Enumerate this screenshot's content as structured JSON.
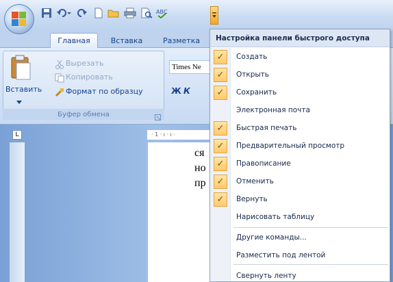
{
  "title_bar": {
    "office_button_icon": "office-logo",
    "qat_icons": [
      "save-icon",
      "undo-icon",
      "redo-icon",
      "new-document-icon",
      "open-folder-icon",
      "quick-print-icon",
      "print-preview-icon",
      "spelling-icon"
    ],
    "customize_icon": "dropdown-arrow-icon"
  },
  "ribbon": {
    "tabs": [
      "Главная",
      "Вставка",
      "Разметка"
    ],
    "clipboard": {
      "paste_label": "Вставить",
      "cut_label": "Вырезать",
      "copy_label": "Копировать",
      "format_painter_label": "Формат по образцу",
      "group_label": "Буфер обмена"
    },
    "font": {
      "name_value": "Times Ne",
      "bold": "Ж",
      "italic": "К"
    }
  },
  "document": {
    "ruler_corner": "L",
    "ruler_marks": "· 1 · ı · ı ·",
    "lines": [
      "ся",
      "но",
      "пр"
    ]
  },
  "menu": {
    "header": "Настройка панели быстрого доступа",
    "items": [
      {
        "label": "Создать",
        "checked": true
      },
      {
        "label": "Открыть",
        "checked": true
      },
      {
        "label": "Сохранить",
        "checked": true
      },
      {
        "label": "Электронная почта",
        "checked": false
      },
      {
        "label": "Быстрая печать",
        "checked": true
      },
      {
        "label": "Предварительный просмотр",
        "checked": true
      },
      {
        "label": "Правописание",
        "checked": true
      },
      {
        "label": "Отменить",
        "checked": true
      },
      {
        "label": "Вернуть",
        "checked": true
      },
      {
        "label": "Нарисовать таблицу",
        "checked": false
      },
      {
        "label": "Другие команды...",
        "checked": false
      },
      {
        "label": "Разместить под лентой",
        "checked": false
      },
      {
        "label": "Свернуть ленту",
        "checked": false
      }
    ],
    "check_glyph": "✓",
    "accent_check_bg": "#ffc96b"
  }
}
